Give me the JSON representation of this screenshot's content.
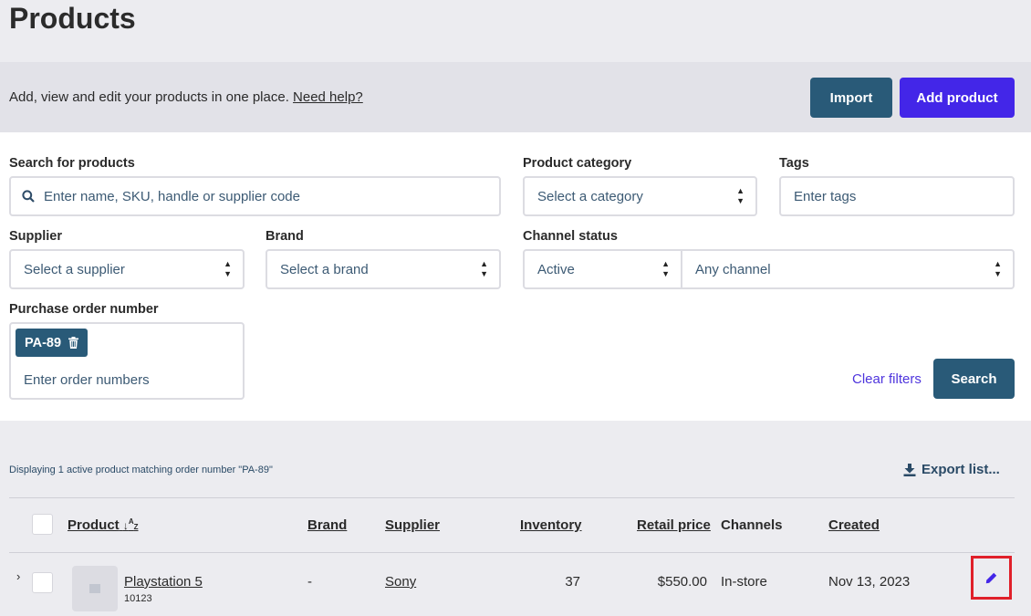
{
  "page": {
    "title": "Products"
  },
  "banner": {
    "text": "Add, view and edit your products in one place.",
    "help_link": "Need help?",
    "import_label": "Import",
    "add_product_label": "Add product"
  },
  "filters": {
    "search": {
      "label": "Search for products",
      "placeholder": "Enter name, SKU, handle or supplier code"
    },
    "category": {
      "label": "Product category",
      "value": "Select a category"
    },
    "tags": {
      "label": "Tags",
      "placeholder": "Enter tags"
    },
    "supplier": {
      "label": "Supplier",
      "value": "Select a supplier"
    },
    "brand": {
      "label": "Brand",
      "value": "Select a brand"
    },
    "channel_status": {
      "label": "Channel status",
      "status_value": "Active",
      "channel_value": "Any channel"
    },
    "purchase_order": {
      "label": "Purchase order number",
      "chip": "PA-89",
      "placeholder": "Enter order numbers"
    },
    "clear_label": "Clear filters",
    "search_label": "Search"
  },
  "results": {
    "count_text": "Displaying 1 active product matching order number \"PA-89\"",
    "export_label": "Export list...",
    "columns": [
      "Product",
      "Brand",
      "Supplier",
      "Inventory",
      "Retail price",
      "Channels",
      "Created"
    ],
    "rows": [
      {
        "name": "Playstation 5",
        "sku": "10123",
        "brand": "-",
        "supplier": "Sony",
        "inventory": "37",
        "retail_price": "$550.00",
        "channels": "In-store",
        "created": "Nov 13, 2023"
      }
    ]
  },
  "icons": {
    "search": "search-icon",
    "trash": "trash-icon",
    "download": "download-icon",
    "edit": "pencil-icon",
    "sort": "sort-icon",
    "expand": "chevron-right-icon"
  },
  "colors": {
    "primary": "#295a78",
    "accent": "#4326e8",
    "highlight": "#e0202a"
  }
}
